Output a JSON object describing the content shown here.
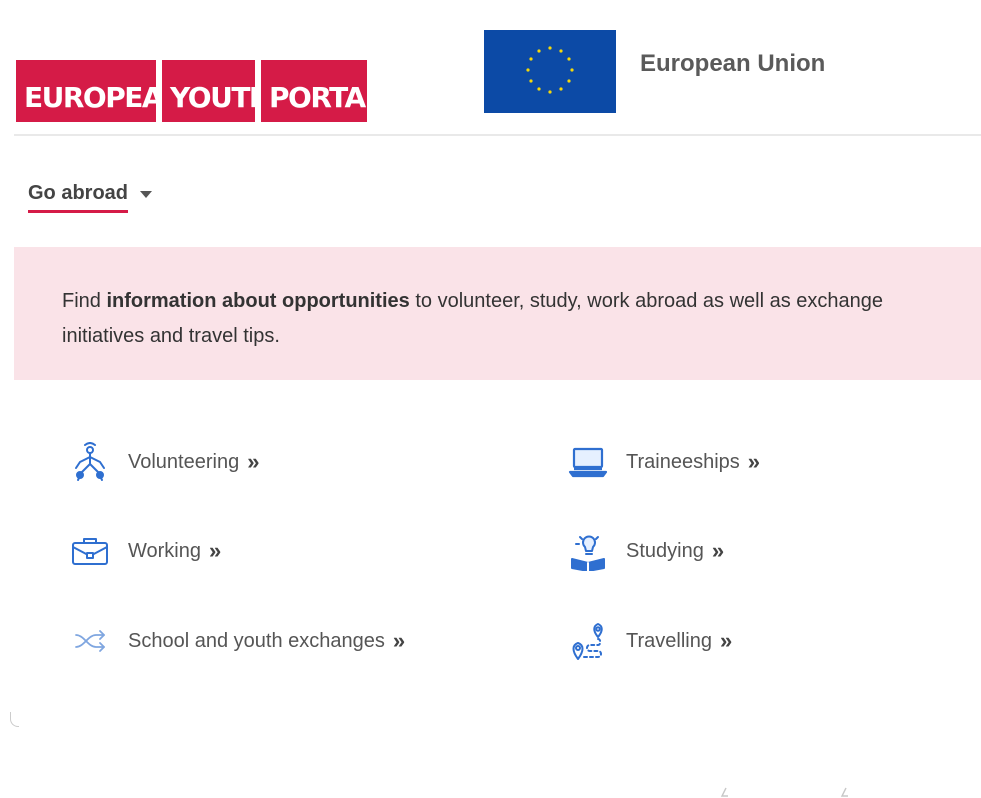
{
  "header": {
    "logo": {
      "words": [
        "EUROPEAN",
        "YOUTH",
        "PORTAL"
      ]
    },
    "eu_label": "European Union",
    "colors": {
      "brand_red": "#d51b47",
      "eu_blue": "#0c4aa6",
      "eu_star": "#f5d90a"
    }
  },
  "nav": {
    "dropdown_label": "Go abroad",
    "dropdown_icon": "caret-down-icon"
  },
  "banner": {
    "text_before": "Find ",
    "text_bold": "information about opportunities",
    "text_after": " to volunteer, study, work abroad as well as exchange initiatives and travel tips.",
    "background": "#fae3e8"
  },
  "links": [
    {
      "label": "Volunteering",
      "icon": "volunteering-icon",
      "arrow": "»"
    },
    {
      "label": "Traineeships",
      "icon": "laptop-icon",
      "arrow": "»"
    },
    {
      "label": "Working",
      "icon": "briefcase-icon",
      "arrow": "»"
    },
    {
      "label": "Studying",
      "icon": "studying-icon",
      "arrow": "»"
    },
    {
      "label": "School and youth exchanges",
      "icon": "exchange-icon",
      "arrow": "»"
    },
    {
      "label": "Travelling",
      "icon": "map-pin-icon",
      "arrow": "»"
    }
  ]
}
